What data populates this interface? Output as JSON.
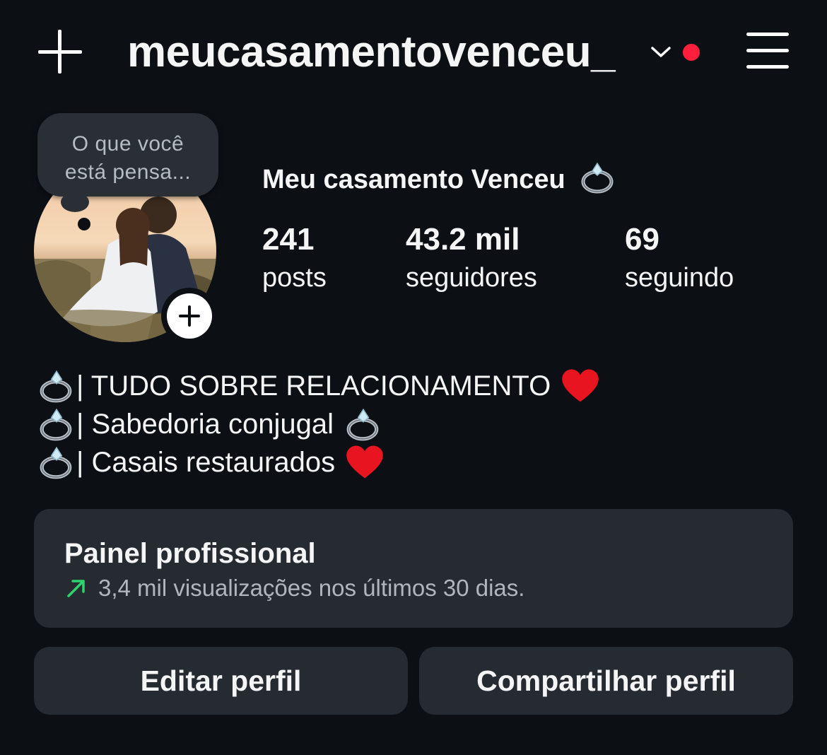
{
  "header": {
    "username": "meucasamentovenceu_",
    "icons": [
      "plus-icon",
      "chevron-down-icon",
      "notification-dot",
      "menu-icon"
    ]
  },
  "note": {
    "text_line1": "O que você",
    "text_line2": "está pensa..."
  },
  "profile": {
    "display_name": "Meu casamento Venceu",
    "stats": {
      "posts": {
        "value": "241",
        "label": "posts"
      },
      "followers": {
        "value": "43.2 mil",
        "label": "seguidores"
      },
      "following": {
        "value": "69",
        "label": "seguindo"
      }
    }
  },
  "bio": {
    "line1": "| TUDO SOBRE RELACIONAMENTO",
    "line2": "| Sabedoria conjugal",
    "line3": "| Casais restaurados"
  },
  "professional_panel": {
    "title": "Painel profissional",
    "subtitle": "3,4 mil visualizações nos últimos 30 dias.",
    "trend_color": "#2fd36b"
  },
  "buttons": {
    "edit_profile": "Editar perfil",
    "share_profile": "Compartilhar perfil"
  },
  "colors": {
    "background": "#0c0f14",
    "card": "#262a31",
    "notification_dot": "#ff1f3d"
  }
}
